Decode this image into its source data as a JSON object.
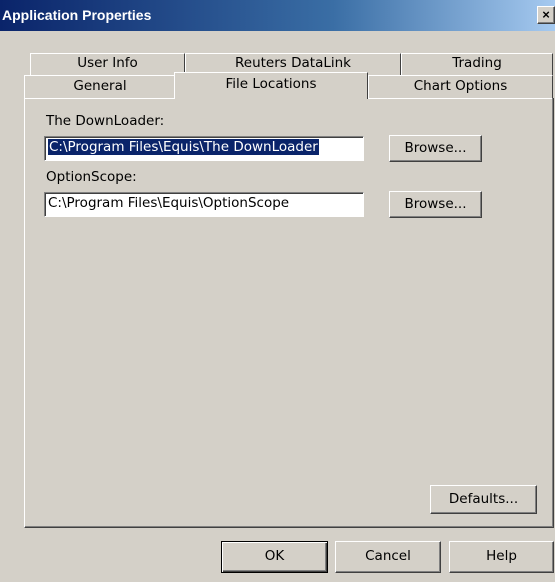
{
  "window": {
    "title": "Application Properties",
    "close_glyph": "×"
  },
  "tabs": {
    "back_row": [
      {
        "label": "User Info"
      },
      {
        "label": "Reuters DataLink"
      },
      {
        "label": "Trading"
      }
    ],
    "front_row": [
      {
        "label": "General"
      },
      {
        "label": "File Locations",
        "active": true
      },
      {
        "label": "Chart Options"
      }
    ]
  },
  "file_locations": {
    "downloader": {
      "label": "The DownLoader:",
      "value": "C:\\Program Files\\Equis\\The DownLoader",
      "browse_label": "Browse..."
    },
    "optionscope": {
      "label": "OptionScope:",
      "value": "C:\\Program Files\\Equis\\OptionScope",
      "browse_label": "Browse..."
    },
    "defaults_label": "Defaults..."
  },
  "footer": {
    "ok_label": "OK",
    "cancel_label": "Cancel",
    "help_label": "Help"
  },
  "colors": {
    "face": "#d4d0c8",
    "title_bar": "#0a246a",
    "selection": "#0a246a"
  },
  "icons": {
    "close": "close-icon"
  }
}
